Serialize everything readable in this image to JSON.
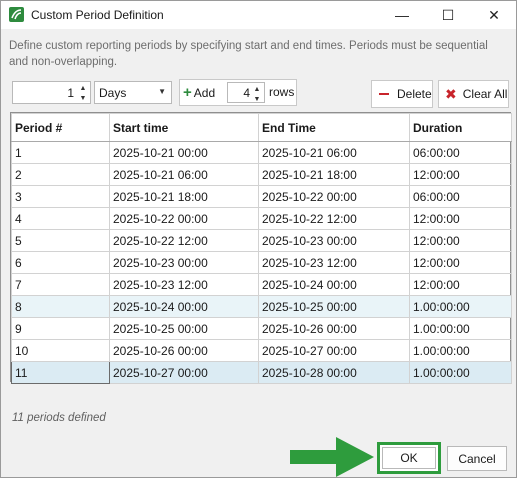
{
  "window": {
    "title": "Custom Period Definition",
    "controls": {
      "minimize": "—",
      "maximize": "☐",
      "close": "✕"
    }
  },
  "description": "Define custom reporting periods by specifying start and end times. Periods must be sequential and non-overlapping.",
  "toolbar": {
    "length_value": "1",
    "unit_value": "Days",
    "add_label": "Add",
    "rows_value": "4",
    "rows_label": "rows",
    "delete_label": "Delete",
    "clear_all_label": "Clear All"
  },
  "table": {
    "columns": [
      "Period #",
      "Start time",
      "End Time",
      "Duration"
    ],
    "rows": [
      [
        "1",
        "2025-10-21 00:00",
        "2025-10-21 06:00",
        "06:00:00"
      ],
      [
        "2",
        "2025-10-21 06:00",
        "2025-10-21 18:00",
        "12:00:00"
      ],
      [
        "3",
        "2025-10-21 18:00",
        "2025-10-22 00:00",
        "06:00:00"
      ],
      [
        "4",
        "2025-10-22 00:00",
        "2025-10-22 12:00",
        "12:00:00"
      ],
      [
        "5",
        "2025-10-22 12:00",
        "2025-10-23 00:00",
        "12:00:00"
      ],
      [
        "6",
        "2025-10-23 00:00",
        "2025-10-23 12:00",
        "12:00:00"
      ],
      [
        "7",
        "2025-10-23 12:00",
        "2025-10-24 00:00",
        "12:00:00"
      ],
      [
        "8",
        "2025-10-24 00:00",
        "2025-10-25 00:00",
        "1.00:00:00"
      ],
      [
        "9",
        "2025-10-25 00:00",
        "2025-10-26 00:00",
        "1.00:00:00"
      ],
      [
        "10",
        "2025-10-26 00:00",
        "2025-10-27 00:00",
        "1.00:00:00"
      ],
      [
        "11",
        "2025-10-27 00:00",
        "2025-10-28 00:00",
        "1.00:00:00"
      ]
    ]
  },
  "status_text": "11 periods defined",
  "buttons": {
    "ok": "OK",
    "cancel": "Cancel"
  },
  "colors": {
    "accent_green": "#2e9c3d",
    "danger_red": "#c8242b",
    "row_tint": "#e9f4f8"
  }
}
